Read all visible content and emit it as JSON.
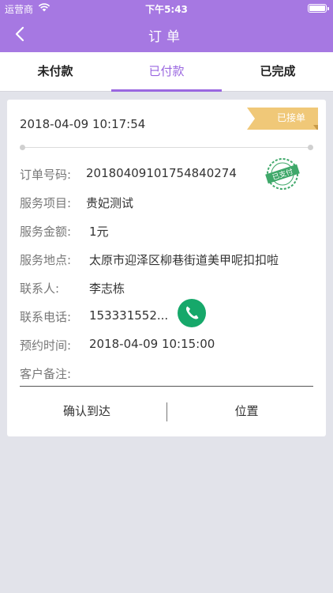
{
  "status_bar": {
    "carrier": "运营商",
    "time": "下午5:43"
  },
  "nav": {
    "title": "订单",
    "back_icon": "chevron-left-icon"
  },
  "tabs": [
    {
      "label": "未付款",
      "active": false
    },
    {
      "label": "已付款",
      "active": true
    },
    {
      "label": "已完成",
      "active": false
    }
  ],
  "order": {
    "datetime": "2018-04-09 10:17:54",
    "status_badge": "已接单",
    "paid_stamp": "已支付",
    "fields": [
      {
        "label": "订单号码:",
        "value": "20180409101754840274"
      },
      {
        "label": "服务项目:",
        "value": "贵妃测试"
      },
      {
        "label": "服务金额:",
        "value": "1元"
      },
      {
        "label": "服务地点:",
        "value": "太原市迎泽区柳巷街道美甲呢扣扣啦"
      },
      {
        "label": "联系人:",
        "value": "李志栋"
      },
      {
        "label": "联系电话:",
        "value": "153331552..."
      },
      {
        "label": "预约时间:",
        "value": "2018-04-09 10:15:00"
      },
      {
        "label": "客户备注:",
        "value": ""
      }
    ],
    "actions": {
      "confirm": "确认到达",
      "location": "位置"
    }
  },
  "colors": {
    "brand": "#a678e2",
    "tab_active": "#9a67e0",
    "ribbon": "#f0c878",
    "stamp": "#3fa86a",
    "phone": "#16a86a"
  }
}
